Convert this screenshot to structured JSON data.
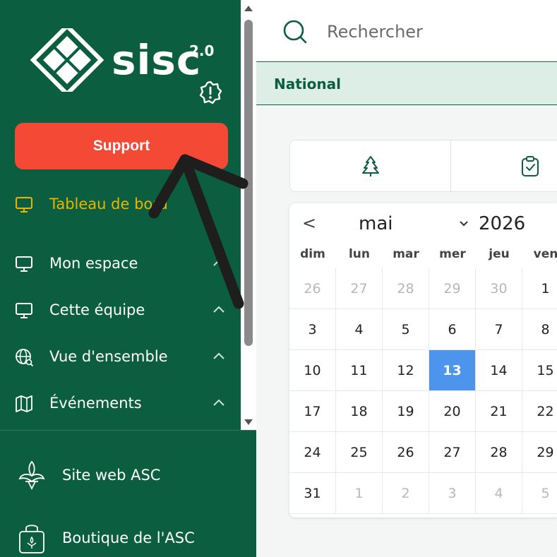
{
  "brand": {
    "logo_text": "sisc",
    "logo_superscript": "2.0"
  },
  "sidebar": {
    "support_label": "Support",
    "items": [
      {
        "label": "Tableau de bord",
        "icon": "monitor-icon",
        "active": true
      },
      {
        "label": "Mon espace",
        "icon": "monitor-icon",
        "active": false
      },
      {
        "label": "Cette équipe",
        "icon": "monitor-icon",
        "active": false
      },
      {
        "label": "Vue d'ensemble",
        "icon": "globe-search-icon",
        "active": false
      },
      {
        "label": "Événements",
        "icon": "map-icon",
        "active": false
      }
    ],
    "bottom_links": [
      {
        "label": "Site web ASC",
        "icon": "fleur-de-lis-icon"
      },
      {
        "label": "Boutique de l'ASC",
        "icon": "shopping-bag-icon"
      }
    ]
  },
  "search": {
    "placeholder": "Rechercher"
  },
  "context": {
    "label": "National"
  },
  "calendar": {
    "month": "mai",
    "year": "2026",
    "weekdays": [
      "dim",
      "lun",
      "mar",
      "mer",
      "jeu",
      "ven"
    ],
    "selected_day": "13",
    "weeks": [
      [
        {
          "d": "26",
          "m": true
        },
        {
          "d": "27",
          "m": true
        },
        {
          "d": "28",
          "m": true
        },
        {
          "d": "29",
          "m": true
        },
        {
          "d": "30",
          "m": true
        },
        {
          "d": "1",
          "m": false
        }
      ],
      [
        {
          "d": "3",
          "m": false
        },
        {
          "d": "4",
          "m": false
        },
        {
          "d": "5",
          "m": false
        },
        {
          "d": "6",
          "m": false
        },
        {
          "d": "7",
          "m": false
        },
        {
          "d": "8",
          "m": false
        }
      ],
      [
        {
          "d": "10",
          "m": false
        },
        {
          "d": "11",
          "m": false
        },
        {
          "d": "12",
          "m": false
        },
        {
          "d": "13",
          "m": false
        },
        {
          "d": "14",
          "m": false
        },
        {
          "d": "15",
          "m": false
        }
      ],
      [
        {
          "d": "17",
          "m": false
        },
        {
          "d": "18",
          "m": false
        },
        {
          "d": "19",
          "m": false
        },
        {
          "d": "20",
          "m": false
        },
        {
          "d": "21",
          "m": false
        },
        {
          "d": "22",
          "m": false
        }
      ],
      [
        {
          "d": "24",
          "m": false
        },
        {
          "d": "25",
          "m": false
        },
        {
          "d": "26",
          "m": false
        },
        {
          "d": "27",
          "m": false
        },
        {
          "d": "28",
          "m": false
        },
        {
          "d": "29",
          "m": false
        }
      ],
      [
        {
          "d": "31",
          "m": false
        },
        {
          "d": "1",
          "m": true
        },
        {
          "d": "2",
          "m": true
        },
        {
          "d": "3",
          "m": true
        },
        {
          "d": "4",
          "m": true
        },
        {
          "d": "5",
          "m": true
        }
      ]
    ]
  },
  "colors": {
    "sidebar_bg": "#0b5e3f",
    "support_bg": "#f44934",
    "active_nav": "#e8b500",
    "selected_day": "#4d94ec"
  }
}
